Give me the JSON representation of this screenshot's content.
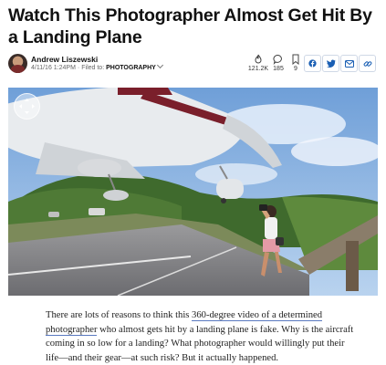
{
  "article": {
    "headline": "Watch This Photographer Almost Get Hit By a Landing Plane",
    "author": "Andrew Liszewski",
    "timestamp": "4/11/16 1:24PM",
    "filed_label": "Filed to:",
    "category": "PHOTOGRAPHY",
    "body_before": "There are lots of reasons to think this ",
    "body_link": "360-degree video of a determined photographer",
    "body_after": " who almost gets hit by a landing plane is fake. Why is the aircraft coming in so low for a landing? What photographer would willingly put their life—and their gear—at such risk? But it actually happened."
  },
  "stats": {
    "views": "121.2K",
    "comments": "185",
    "saves": "9"
  },
  "share_icons": [
    "facebook-icon",
    "twitter-icon",
    "email-icon",
    "link-icon"
  ],
  "colors": {
    "share_blue": "#1a5fb4",
    "link_underline": "#5a7ac0",
    "plane_stripe": "#7a1f2b"
  }
}
